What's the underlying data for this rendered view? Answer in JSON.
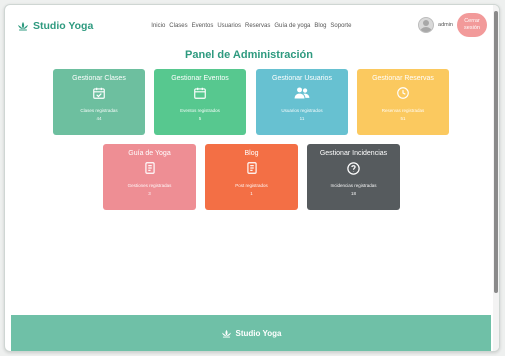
{
  "brand": {
    "name": "Studio Yoga",
    "color": "#2e9a7f"
  },
  "nav": [
    {
      "label": "Inicio"
    },
    {
      "label": "Clases"
    },
    {
      "label": "Eventos"
    },
    {
      "label": "Usuarios"
    },
    {
      "label": "Reservas"
    },
    {
      "label": "Guía de yoga"
    },
    {
      "label": "Blog"
    },
    {
      "label": "Soporte"
    }
  ],
  "user": {
    "name": "admin",
    "logout_label": "Cerrar sesión"
  },
  "page": {
    "title": "Panel de Administración"
  },
  "cards": [
    {
      "title": "Gestionar Clases",
      "icon": "calendar-check-icon",
      "label": "Clases registradas",
      "count": "44",
      "color": "#6dbf9f"
    },
    {
      "title": "Gestionar Eventos",
      "icon": "calendar-icon",
      "label": "Eventos registrados",
      "count": "5",
      "color": "#57c88f"
    },
    {
      "title": "Gestionar Usuarios",
      "icon": "users-icon",
      "label": "Usuarios registrados",
      "count": "11",
      "color": "#67c1d1"
    },
    {
      "title": "Gestionar Reservas",
      "icon": "clock-icon",
      "label": "Reservas registradas",
      "count": "51",
      "color": "#fbc95f"
    },
    {
      "title": "Guía de Yoga",
      "icon": "document-icon",
      "label": "Gestiones registradas",
      "count": "3",
      "color": "#ee8e94"
    },
    {
      "title": "Blog",
      "icon": "document-icon",
      "label": "Post registrados",
      "count": "1",
      "color": "#f36f45"
    },
    {
      "title": "Gestionar Incidencias",
      "icon": "question-icon",
      "label": "Incidencias registradas",
      "count": "18",
      "color": "#565b5e"
    }
  ],
  "footer": {
    "brand": "Studio Yoga"
  }
}
